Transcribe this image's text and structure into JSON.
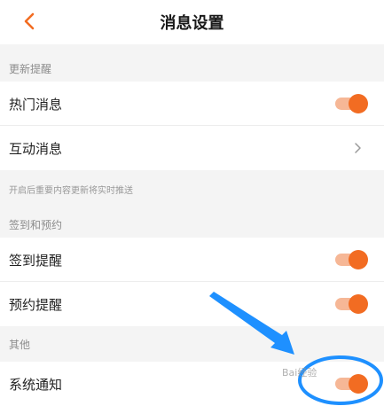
{
  "header": {
    "title": "消息设置"
  },
  "sections": {
    "update": {
      "label": "更新提醒",
      "hot": "热门消息",
      "interact": "互动消息",
      "hint": "开启后重要内容更新将实时推送"
    },
    "signin": {
      "label": "签到和预约",
      "signin_reminder": "签到提醒",
      "booking_reminder": "预约提醒"
    },
    "other": {
      "label": "其他",
      "system": "系统通知"
    }
  },
  "toggles": {
    "hot": true,
    "signin": true,
    "booking": true,
    "system": true
  },
  "watermark": "Bai经验",
  "colors": {
    "accent": "#f26c22",
    "annotation": "#1e90ff"
  },
  "icons": {
    "back": "chevron-left-icon",
    "chevron": "chevron-right-icon"
  }
}
